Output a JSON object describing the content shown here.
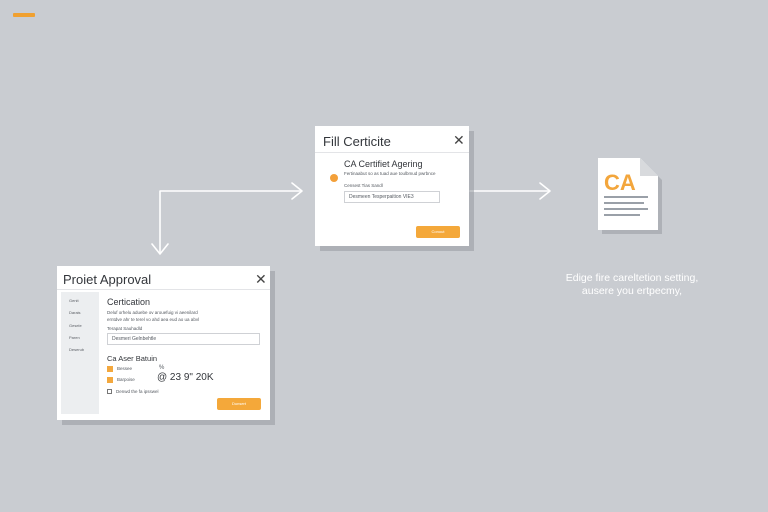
{
  "corner_logo": "logo",
  "colors": {
    "background": "#c9ccd1",
    "accent": "#f4a83a",
    "arrow": "#ffffff"
  },
  "certificate_dialog": {
    "title": "Fill Certicite",
    "section_heading": "CA Certifiet Agering",
    "description": "Fertinaabut so as tuad aue toulbmud pwrbnce",
    "field_label": "Censest Tias Sandl",
    "field_value": "Desmeen Tesperpaition VIE3",
    "button_label": "Conout"
  },
  "approval_dialog": {
    "title": "Proiet Approval",
    "sidebar_items": [
      "Genit",
      "Darais",
      "Gesele",
      "Paren",
      "Deserub"
    ],
    "section_heading": "Certication",
    "description_line1": "Deluf orhelu aduebe ov arouefuig vi aeenilard",
    "description_line2": "erntdve ahr te terel vo ahd aea eud ao ua abvl",
    "field_label": "Terapat Sauhadld",
    "field_value": "Desmeri Gelnbehtle",
    "subsection_heading": "Ca Aser Batuin",
    "option1_label": "Bessee",
    "option1_value": "%",
    "option2_label": "Barpoise",
    "option2_value": "@ 23 9\" 20K",
    "checkbox_label": "Denwd the fa ipsswel",
    "button_label": "Dunsert"
  },
  "document_icon": {
    "icon": "document-icon",
    "label": "CA"
  },
  "caption": {
    "line1": "Edige fire careltetion setting,",
    "line2": "ausere you ertpecmy,"
  }
}
